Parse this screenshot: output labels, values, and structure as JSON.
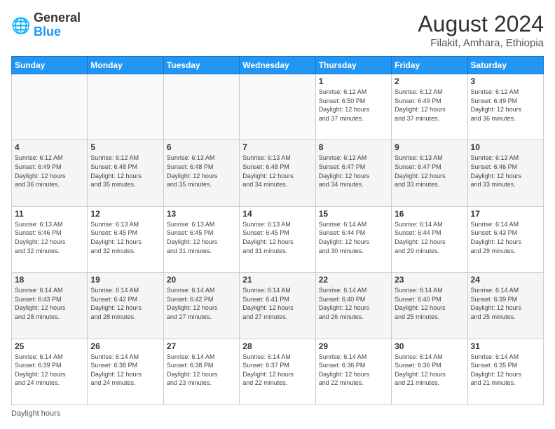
{
  "header": {
    "logo_general": "General",
    "logo_blue": "Blue",
    "month_year": "August 2024",
    "location": "Filakit, Amhara, Ethiopia"
  },
  "footer": {
    "note": "Daylight hours"
  },
  "days_of_week": [
    "Sunday",
    "Monday",
    "Tuesday",
    "Wednesday",
    "Thursday",
    "Friday",
    "Saturday"
  ],
  "weeks": [
    [
      {
        "day": "",
        "info": ""
      },
      {
        "day": "",
        "info": ""
      },
      {
        "day": "",
        "info": ""
      },
      {
        "day": "",
        "info": ""
      },
      {
        "day": "1",
        "info": "Sunrise: 6:12 AM\nSunset: 6:50 PM\nDaylight: 12 hours\nand 37 minutes."
      },
      {
        "day": "2",
        "info": "Sunrise: 6:12 AM\nSunset: 6:49 PM\nDaylight: 12 hours\nand 37 minutes."
      },
      {
        "day": "3",
        "info": "Sunrise: 6:12 AM\nSunset: 6:49 PM\nDaylight: 12 hours\nand 36 minutes."
      }
    ],
    [
      {
        "day": "4",
        "info": "Sunrise: 6:12 AM\nSunset: 6:49 PM\nDaylight: 12 hours\nand 36 minutes."
      },
      {
        "day": "5",
        "info": "Sunrise: 6:12 AM\nSunset: 6:48 PM\nDaylight: 12 hours\nand 35 minutes."
      },
      {
        "day": "6",
        "info": "Sunrise: 6:13 AM\nSunset: 6:48 PM\nDaylight: 12 hours\nand 35 minutes."
      },
      {
        "day": "7",
        "info": "Sunrise: 6:13 AM\nSunset: 6:48 PM\nDaylight: 12 hours\nand 34 minutes."
      },
      {
        "day": "8",
        "info": "Sunrise: 6:13 AM\nSunset: 6:47 PM\nDaylight: 12 hours\nand 34 minutes."
      },
      {
        "day": "9",
        "info": "Sunrise: 6:13 AM\nSunset: 6:47 PM\nDaylight: 12 hours\nand 33 minutes."
      },
      {
        "day": "10",
        "info": "Sunrise: 6:13 AM\nSunset: 6:46 PM\nDaylight: 12 hours\nand 33 minutes."
      }
    ],
    [
      {
        "day": "11",
        "info": "Sunrise: 6:13 AM\nSunset: 6:46 PM\nDaylight: 12 hours\nand 32 minutes."
      },
      {
        "day": "12",
        "info": "Sunrise: 6:13 AM\nSunset: 6:45 PM\nDaylight: 12 hours\nand 32 minutes."
      },
      {
        "day": "13",
        "info": "Sunrise: 6:13 AM\nSunset: 6:45 PM\nDaylight: 12 hours\nand 31 minutes."
      },
      {
        "day": "14",
        "info": "Sunrise: 6:13 AM\nSunset: 6:45 PM\nDaylight: 12 hours\nand 31 minutes."
      },
      {
        "day": "15",
        "info": "Sunrise: 6:14 AM\nSunset: 6:44 PM\nDaylight: 12 hours\nand 30 minutes."
      },
      {
        "day": "16",
        "info": "Sunrise: 6:14 AM\nSunset: 6:44 PM\nDaylight: 12 hours\nand 29 minutes."
      },
      {
        "day": "17",
        "info": "Sunrise: 6:14 AM\nSunset: 6:43 PM\nDaylight: 12 hours\nand 29 minutes."
      }
    ],
    [
      {
        "day": "18",
        "info": "Sunrise: 6:14 AM\nSunset: 6:43 PM\nDaylight: 12 hours\nand 28 minutes."
      },
      {
        "day": "19",
        "info": "Sunrise: 6:14 AM\nSunset: 6:42 PM\nDaylight: 12 hours\nand 28 minutes."
      },
      {
        "day": "20",
        "info": "Sunrise: 6:14 AM\nSunset: 6:42 PM\nDaylight: 12 hours\nand 27 minutes."
      },
      {
        "day": "21",
        "info": "Sunrise: 6:14 AM\nSunset: 6:41 PM\nDaylight: 12 hours\nand 27 minutes."
      },
      {
        "day": "22",
        "info": "Sunrise: 6:14 AM\nSunset: 6:40 PM\nDaylight: 12 hours\nand 26 minutes."
      },
      {
        "day": "23",
        "info": "Sunrise: 6:14 AM\nSunset: 6:40 PM\nDaylight: 12 hours\nand 25 minutes."
      },
      {
        "day": "24",
        "info": "Sunrise: 6:14 AM\nSunset: 6:39 PM\nDaylight: 12 hours\nand 25 minutes."
      }
    ],
    [
      {
        "day": "25",
        "info": "Sunrise: 6:14 AM\nSunset: 6:39 PM\nDaylight: 12 hours\nand 24 minutes."
      },
      {
        "day": "26",
        "info": "Sunrise: 6:14 AM\nSunset: 6:38 PM\nDaylight: 12 hours\nand 24 minutes."
      },
      {
        "day": "27",
        "info": "Sunrise: 6:14 AM\nSunset: 6:38 PM\nDaylight: 12 hours\nand 23 minutes."
      },
      {
        "day": "28",
        "info": "Sunrise: 6:14 AM\nSunset: 6:37 PM\nDaylight: 12 hours\nand 22 minutes."
      },
      {
        "day": "29",
        "info": "Sunrise: 6:14 AM\nSunset: 6:36 PM\nDaylight: 12 hours\nand 22 minutes."
      },
      {
        "day": "30",
        "info": "Sunrise: 6:14 AM\nSunset: 6:36 PM\nDaylight: 12 hours\nand 21 minutes."
      },
      {
        "day": "31",
        "info": "Sunrise: 6:14 AM\nSunset: 6:35 PM\nDaylight: 12 hours\nand 21 minutes."
      }
    ]
  ]
}
